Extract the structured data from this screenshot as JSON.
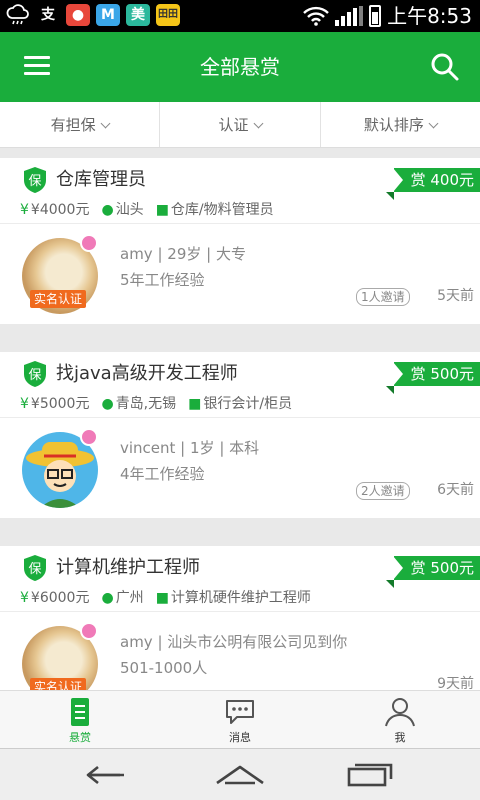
{
  "status_bar": {
    "left_icons": [
      "weather-icon",
      "alipay-icon",
      "cow-app-icon",
      "m-app-icon",
      "meituan-icon",
      "ticket-app-icon"
    ],
    "app_chars": [
      "支",
      "M",
      "美",
      "田田"
    ],
    "time": "上午8:53"
  },
  "header": {
    "title": "全部悬赏"
  },
  "filters": [
    "有担保",
    "认证",
    "默认排序"
  ],
  "listings": [
    {
      "title": "仓库管理员",
      "reward": "赏 400元",
      "salary": "¥4000元",
      "location": "汕头",
      "category": "仓库/物料管理员",
      "person_info": "amy | 29岁 | 大专",
      "experience": "5年工作经验",
      "verified": "实名认证",
      "invites": "1人邀请",
      "posted": "5天前"
    },
    {
      "title": "找java高级开发工程师",
      "reward": "赏 500元",
      "salary": "¥5000元",
      "location": "青岛,无锡",
      "category": "银行会计/柜员",
      "person_info": "vincent | 1岁 | 本科",
      "experience": "4年工作经验",
      "verified": "",
      "invites": "2人邀请",
      "posted": "6天前"
    },
    {
      "title": "计算机维护工程师",
      "reward": "赏 500元",
      "salary": "¥6000元",
      "location": "广州",
      "category": "计算机硬件维护工程师",
      "person_info": "amy | 汕头市公明有限公司见到你",
      "experience": "501-1000人",
      "verified": "实名认证",
      "invites": "",
      "posted": "9天前"
    }
  ],
  "bao_label": "保",
  "tabs": [
    {
      "label": "悬赏",
      "icon": "document-icon",
      "active": true
    },
    {
      "label": "消息",
      "icon": "chat-icon",
      "active": false
    },
    {
      "label": "我",
      "icon": "person-icon",
      "active": false
    }
  ],
  "colors": {
    "brand_green": "#1aad3c",
    "verified_orange": "#f06a1e",
    "status_bar": "#000000"
  }
}
